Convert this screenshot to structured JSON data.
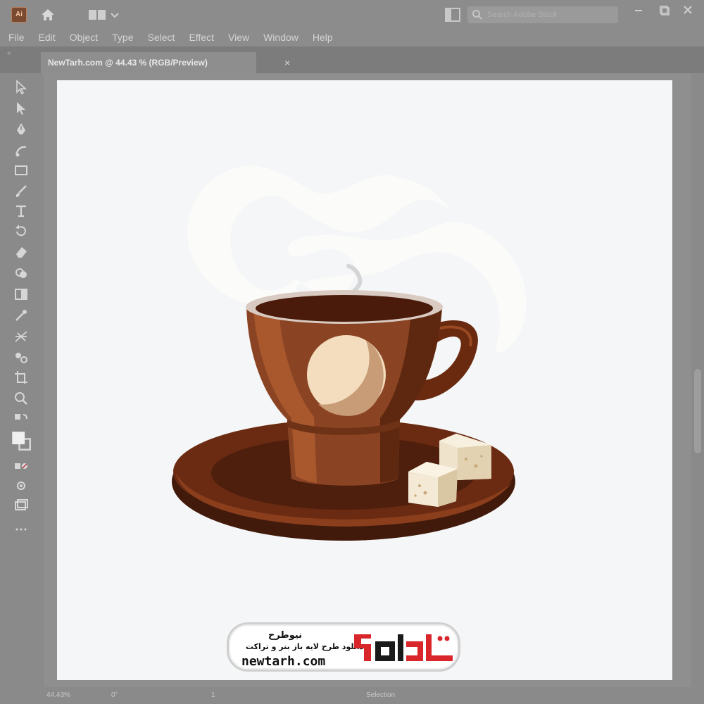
{
  "app": {
    "icon_text": "Ai"
  },
  "search": {
    "placeholder": "Search Adobe Stock"
  },
  "menu": [
    "File",
    "Edit",
    "Object",
    "Type",
    "Select",
    "Effect",
    "View",
    "Window",
    "Help"
  ],
  "document_tab": {
    "label": "NewTarh.com @ 44.43 % (RGB/Preview)",
    "close": "×"
  },
  "tools": [
    "selection-tool",
    "direct-selection-tool",
    "pen-tool",
    "curvature-tool",
    "rectangle-tool",
    "paintbrush-tool",
    "type-tool",
    "rotate-tool",
    "eraser-tool",
    "shape-builder-tool",
    "gradient-tool",
    "eyedropper-tool",
    "mesh-tool",
    "blend-tool",
    "artboard-tool",
    "zoom-tool"
  ],
  "status": {
    "zoom": "44.43%",
    "rotation": "0°",
    "page": "1",
    "active_tool": "Selection"
  },
  "watermark": {
    "title": "نیوطرح",
    "subtitle": "دانلود طرح لایه باز بنر و تراکت",
    "url": "newtarh.com",
    "logo_text": "نیوطرح"
  },
  "colors": {
    "ui_gray": "#8c8c8c",
    "artboard": "#f5f6f7",
    "cup_brown": "#8a4524",
    "saucer": "#5a2410",
    "logo_red": "#d9262b"
  }
}
